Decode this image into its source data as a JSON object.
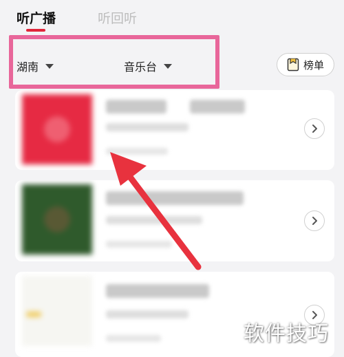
{
  "tabs": [
    {
      "label": "听广播",
      "active": true
    },
    {
      "label": "听回听",
      "active": false
    }
  ],
  "filters": {
    "region": "湖南",
    "station_type": "音乐台"
  },
  "rank_button": {
    "label": "榜单",
    "icon": "rank-list-icon"
  },
  "stations": [
    {
      "thumbnail_color": "#e62a43"
    },
    {
      "thumbnail_color": "#2f5a2c"
    },
    {
      "thumbnail_color": "#f6f6f2"
    }
  ],
  "colors": {
    "accent": "#e0253a",
    "highlight_box": "#e8669a",
    "annotation_arrow": "#e8323e"
  },
  "watermark": "软件技巧"
}
